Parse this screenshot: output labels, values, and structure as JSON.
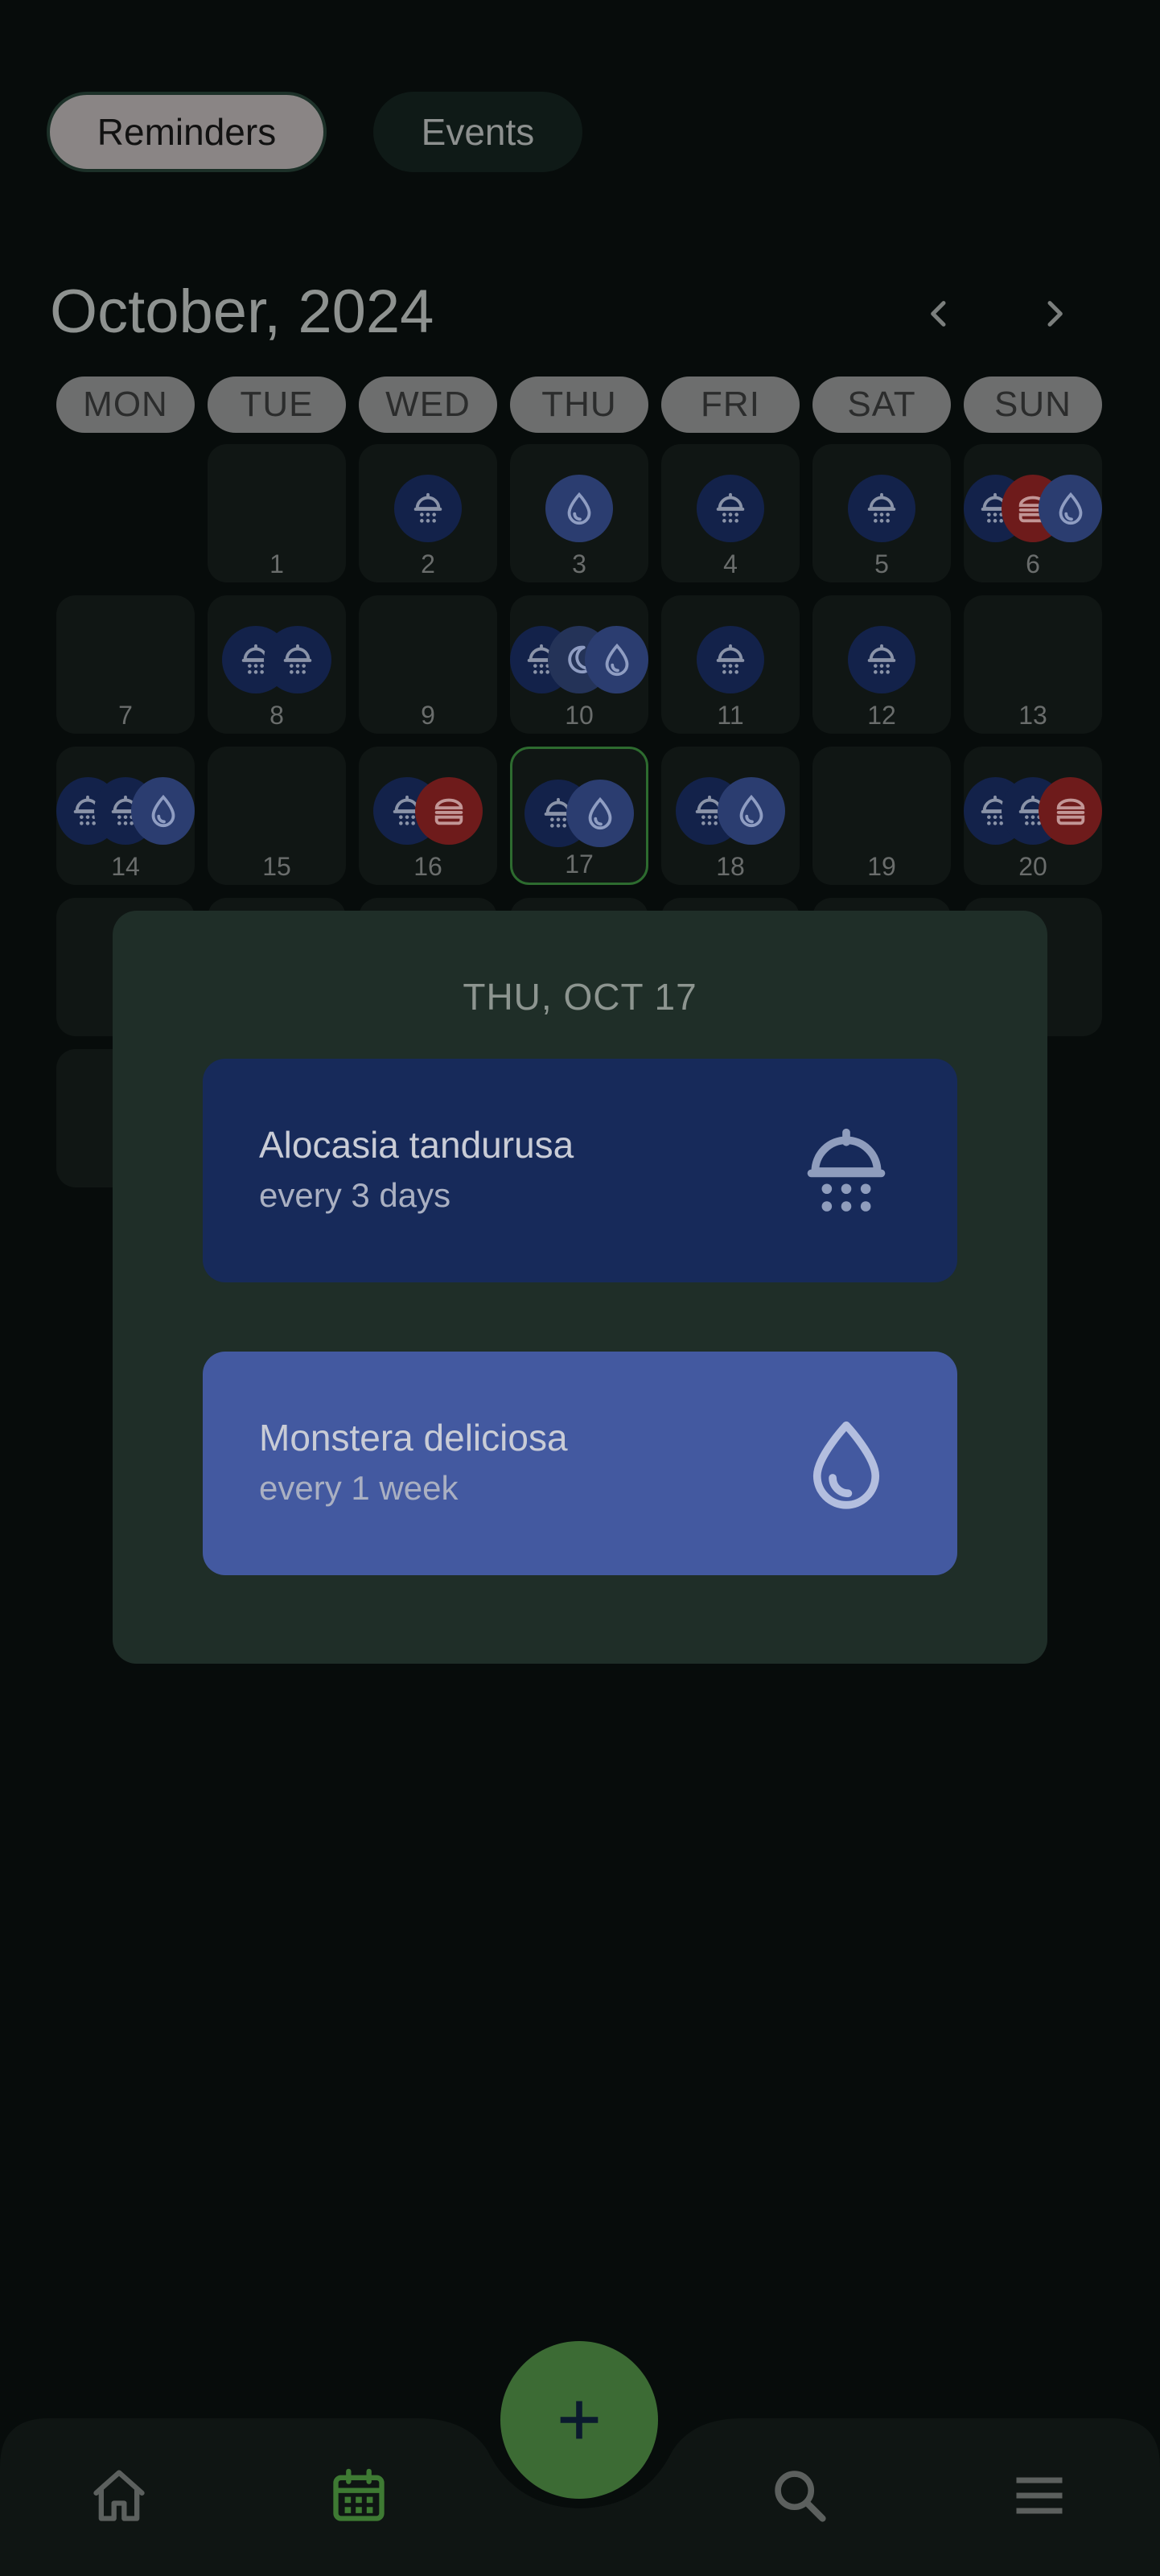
{
  "tabs": {
    "reminders": "Reminders",
    "events": "Events"
  },
  "calendar": {
    "month_label": "October, 2024",
    "weekdays": [
      "MON",
      "TUE",
      "WED",
      "THU",
      "FRI",
      "SAT",
      "SUN"
    ],
    "today": "17",
    "days": [
      {
        "n": "",
        "icons": []
      },
      {
        "n": "1",
        "icons": []
      },
      {
        "n": "2",
        "icons": [
          "mist"
        ]
      },
      {
        "n": "3",
        "icons": [
          "water"
        ]
      },
      {
        "n": "4",
        "icons": [
          "mist"
        ]
      },
      {
        "n": "5",
        "icons": [
          "mist"
        ]
      },
      {
        "n": "6",
        "icons": [
          "mist",
          "food",
          "water"
        ]
      },
      {
        "n": "7",
        "icons": []
      },
      {
        "n": "8",
        "icons": [
          "mist",
          "mist"
        ]
      },
      {
        "n": "9",
        "icons": []
      },
      {
        "n": "10",
        "icons": [
          "mist",
          "moon",
          "water"
        ]
      },
      {
        "n": "11",
        "icons": [
          "mist"
        ]
      },
      {
        "n": "12",
        "icons": [
          "mist"
        ]
      },
      {
        "n": "13",
        "icons": []
      },
      {
        "n": "14",
        "icons": [
          "mist",
          "mist",
          "water"
        ]
      },
      {
        "n": "15",
        "icons": []
      },
      {
        "n": "16",
        "icons": [
          "mist",
          "food"
        ]
      },
      {
        "n": "17",
        "icons": [
          "mist",
          "water"
        ]
      },
      {
        "n": "18",
        "icons": [
          "mist",
          "water"
        ]
      },
      {
        "n": "19",
        "icons": []
      },
      {
        "n": "20",
        "icons": [
          "mist",
          "mist",
          "food"
        ]
      }
    ]
  },
  "popup": {
    "date": "THU, OCT 17",
    "items": [
      {
        "name": "Alocasia tandurusa",
        "freq": "every 3 days",
        "icon": "shower-icon"
      },
      {
        "name": "Monstera deliciosa",
        "freq": "every 1 week",
        "icon": "water-drop-icon"
      }
    ]
  },
  "bottom_nav": {
    "items": [
      "home-icon",
      "calendar-icon",
      "search-icon",
      "menu-icon"
    ],
    "fab": "add-icon"
  },
  "colors": {
    "accent": "#3c6b34",
    "mist": "#13224a",
    "water": "#2b3d70",
    "food": "#6e1b1b"
  }
}
